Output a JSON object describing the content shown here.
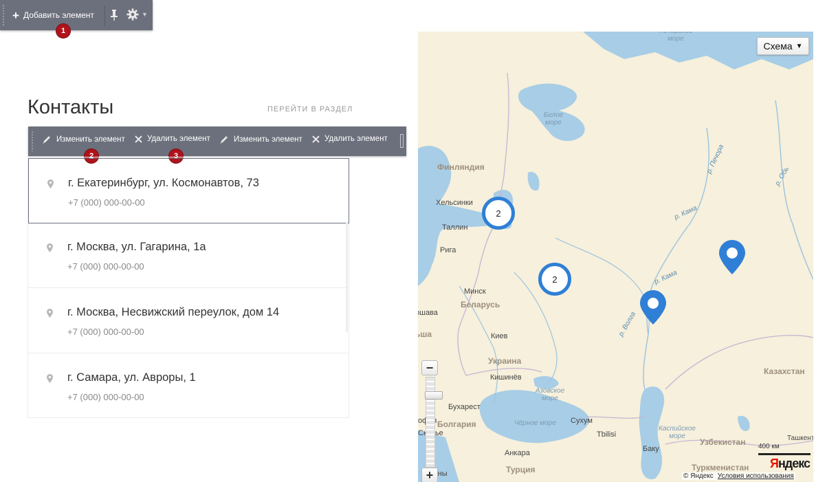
{
  "toolbar": {
    "add_label": "Добавить элемент",
    "badge_add": "1"
  },
  "section": {
    "title": "Контакты",
    "goto_label": "ПЕРЕЙТИ В РАЗДЕЛ"
  },
  "edit_bar": {
    "edit_label_1": "Изменить элемент",
    "delete_label_1": "Удалить элемент",
    "edit_label_2": "Изменить элемент",
    "delete_label_2": "Удалить элемент",
    "badge_edit": "2",
    "badge_delete": "3"
  },
  "contacts": [
    {
      "address": "г. Екатеринбург, ул. Космонавтов, 73",
      "phone": "+7 (000) 000-00-00"
    },
    {
      "address": "г. Москва, ул. Гагарина, 1а",
      "phone": "+7 (000) 000-00-00"
    },
    {
      "address": "г. Москва, Несвижский переулок, дом 14",
      "phone": "+7 (000) 000-00-00"
    },
    {
      "address": "г. Самара, ул. Авроры, 1",
      "phone": "+7 (000) 000-00-00"
    }
  ],
  "map": {
    "scheme_label": "Схема",
    "clusters": [
      "2",
      "2"
    ],
    "zoom_plus": "+",
    "zoom_minus": "−",
    "scale_label": "400 км",
    "logo_a": "Я",
    "logo_b": "ндекс",
    "copyright": "© Яндекс",
    "terms": "Условия использования",
    "labels": {
      "finland": "Финляндия",
      "helsinki": "Хельсинки",
      "tallinn": "Таллин",
      "riga": "Рига",
      "minsk": "Минск",
      "belarus": "Беларусь",
      "kiev": "Киев",
      "ukraine": "Украина",
      "chisinau": "Кишинёв",
      "bucharest": "Бухарест",
      "bulgaria": "Болгария",
      "sukhum": "Сухум",
      "tbilisi": "Tbilisi",
      "baku": "Баку",
      "ankara": "Анкара",
      "turkey": "Турция",
      "kazakhstan": "Казахстан",
      "uzbekistan": "Узбекистан",
      "turkmenistan": "Туркменистан",
      "tashkent": "Ташкент",
      "white_sea": "Белое море",
      "barents_sea": "Печорское море",
      "azov_sea": "Азовское море",
      "black_sea": "Чёрное море",
      "caspian_sea": "Каспийское море",
      "pechora": "р. Печора",
      "ob": "р. Обь",
      "kama1": "р. Кама",
      "kama2": "р. Кама",
      "volga": "р. Волга",
      "warsaw_partial": "ршава",
      "vilnius_partial": "ьша",
      "sofia_partial": "офия",
      "skopje_partial": "Скопье",
      "athens_partial": "Афины"
    }
  },
  "colors": {
    "toolbar_bg": "#6c707c",
    "badge": "#b0131b",
    "cluster": "#2f7fd6",
    "water": "#a8cde6",
    "land": "#f6f0dc"
  }
}
